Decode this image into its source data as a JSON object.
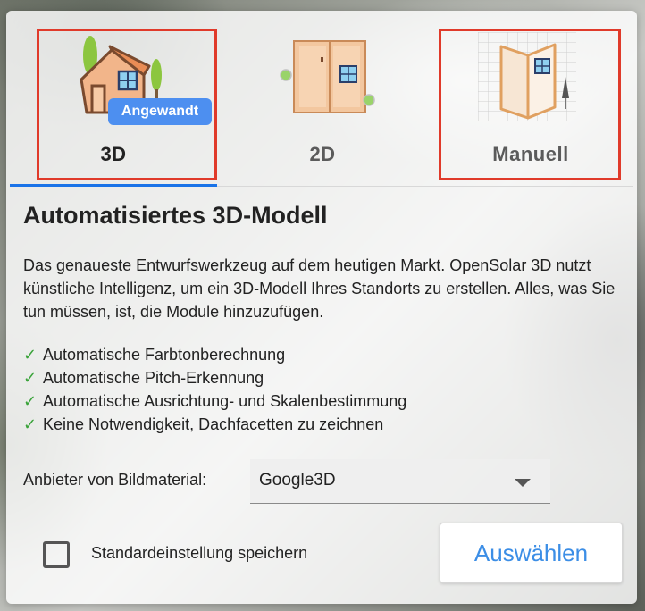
{
  "tabs": [
    {
      "label": "3D",
      "badge": "Angewandt"
    },
    {
      "label": "2D"
    },
    {
      "label": "Manuell"
    }
  ],
  "content": {
    "title": "Automatisiertes 3D-Modell",
    "description": "Das genaueste Entwurfswerkzeug auf dem heutigen Markt. OpenSolar 3D nutzt künstliche Intelligenz, um ein 3D-Modell Ihres Standorts zu erstellen. Alles, was Sie tun müssen, ist, die Module hinzuzufügen.",
    "features": [
      "Automatische Farbtonberechnung",
      "Automatische Pitch-Erkennung",
      "Automatische Ausrichtung- und Skalenbestimmung",
      "Keine Notwendigkeit, Dachfacetten zu zeichnen"
    ],
    "check_mark": "✓"
  },
  "imagery": {
    "label": "Anbieter von Bildmaterial:",
    "selected": "Google3D"
  },
  "footer": {
    "save_default_label": "Standardeinstellung speichern",
    "select_button": "Auswählen"
  },
  "colors": {
    "accent": "#1a73e8",
    "badge": "#4d8ff0",
    "highlight": "#e03a2a",
    "check": "#3aa33a"
  }
}
